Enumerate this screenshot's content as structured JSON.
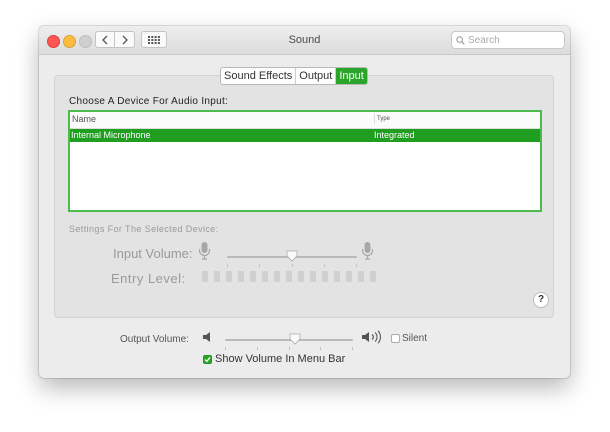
{
  "window": {
    "title": "Sound",
    "search_placeholder": "Search"
  },
  "tabs": [
    {
      "label": "Sound Effects",
      "selected": false
    },
    {
      "label": "Output",
      "selected": false
    },
    {
      "label": "Input",
      "selected": true
    }
  ],
  "input": {
    "choose_label": "Choose A Device For Audio Input:",
    "columns": {
      "name": "Name",
      "type": "Type"
    },
    "devices": [
      {
        "name": "Internal Microphone",
        "type": "Integrated",
        "selected": true
      }
    ],
    "settings_label": "Settings For The Selected Device:",
    "input_volume_label": "Input Volume:",
    "input_volume_value": 0.5,
    "entry_level_label": "Entry Level:",
    "entry_level_value": 0
  },
  "output": {
    "volume_label": "Output Volume:",
    "volume_value": 0.55,
    "silent_label": "Silent",
    "silent_checked": false,
    "show_volume_label": "Show Volume In Menu Bar",
    "show_volume_checked": true
  },
  "colors": {
    "accent": "#2aa52a",
    "highlight_border": "#4cbb4c"
  }
}
